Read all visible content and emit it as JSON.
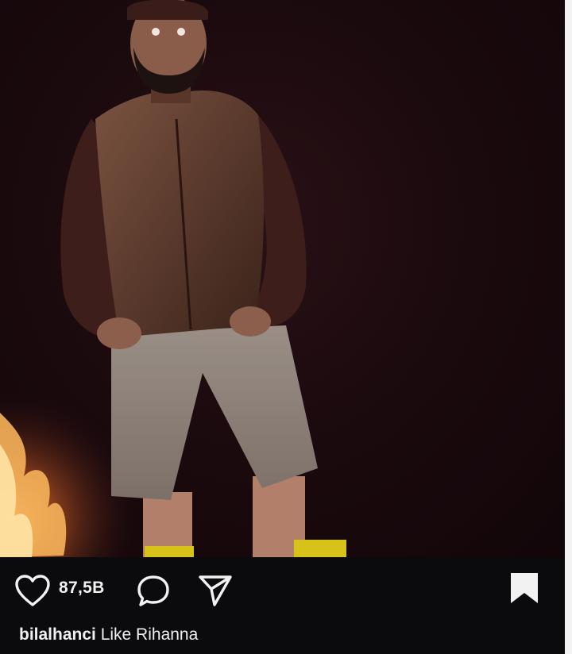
{
  "post": {
    "likes_count": "87,5B",
    "username": "bilalhanci",
    "caption_text": "Like Rihanna"
  },
  "icons": {
    "like": "heart-icon",
    "comment": "comment-bubble-icon",
    "share": "send-arrow-icon",
    "save": "bookmark-icon"
  },
  "colors": {
    "bar_background": "#0b0b0d",
    "text": "#f2f2f2",
    "photo_background": "#1b0a0e",
    "fire": "#f4a64a"
  }
}
